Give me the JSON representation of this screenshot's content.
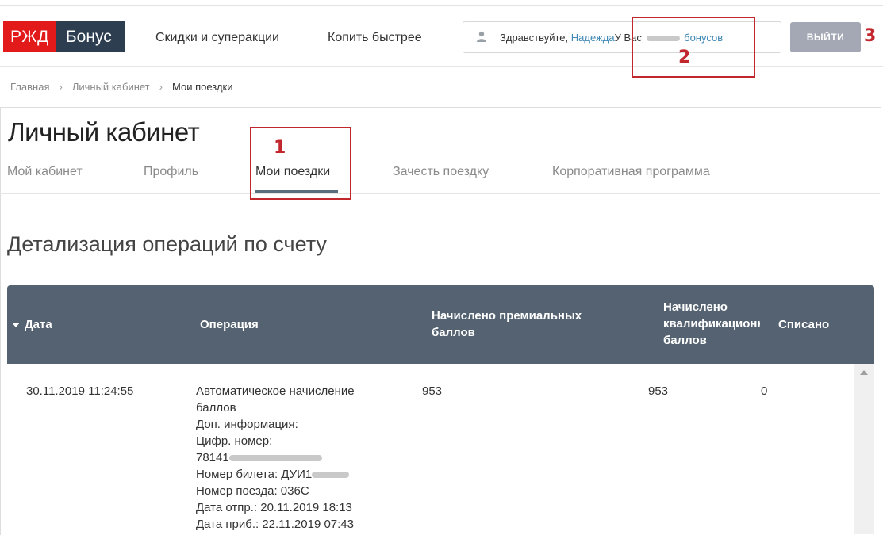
{
  "header": {
    "logo_left": "РЖД",
    "logo_right": "Бонус",
    "nav": [
      "Скидки и суперакции",
      "Копить быстрее"
    ],
    "greeting_prefix": "Здравствуйте,",
    "user_name": "Надежда",
    "balance_prefix": "У Вас",
    "balance_suffix": "бонусов",
    "logout": "ВЫЙТИ"
  },
  "annotations": [
    "1",
    "2",
    "3"
  ],
  "breadcrumb": [
    "Главная",
    "Личный кабинет",
    "Мои поездки"
  ],
  "page_title": "Личный кабинет",
  "tabs": [
    "Мой кабинет",
    "Профиль",
    "Мои поездки",
    "Зачесть поездку",
    "Корпоративная программа"
  ],
  "active_tab": "Мои поездки",
  "section_title": "Детализация операций по счету",
  "table": {
    "columns": {
      "date": "Дата",
      "operation": "Операция",
      "premium_1": "Начислено премиальных",
      "premium_2": "баллов",
      "qual_1": "Начислено",
      "qual_2": "квалификационных",
      "qual_3": "баллов",
      "written_off": "Списано"
    },
    "rows": [
      {
        "date": "30.11.2019 11:24:55",
        "operation_lines": [
          "Автоматическое начисление",
          "баллов",
          "Доп. информация:",
          "Цифр. номер:",
          "78141",
          "Номер билета: ДУИ1",
          "Номер поезда: 036С",
          "Дата отпр.: 20.11.2019 18:13",
          "Дата приб.: 22.11.2019 07:43"
        ],
        "premium": "953",
        "qualification": "953",
        "written_off": "0"
      }
    ]
  },
  "colors": {
    "logo_red": "#e21a1a",
    "logo_dark": "#2c3e50",
    "table_header": "#546271",
    "link": "#3f88b5",
    "annotation": "#c1272d",
    "logout_bg": "#a3a8b4"
  }
}
